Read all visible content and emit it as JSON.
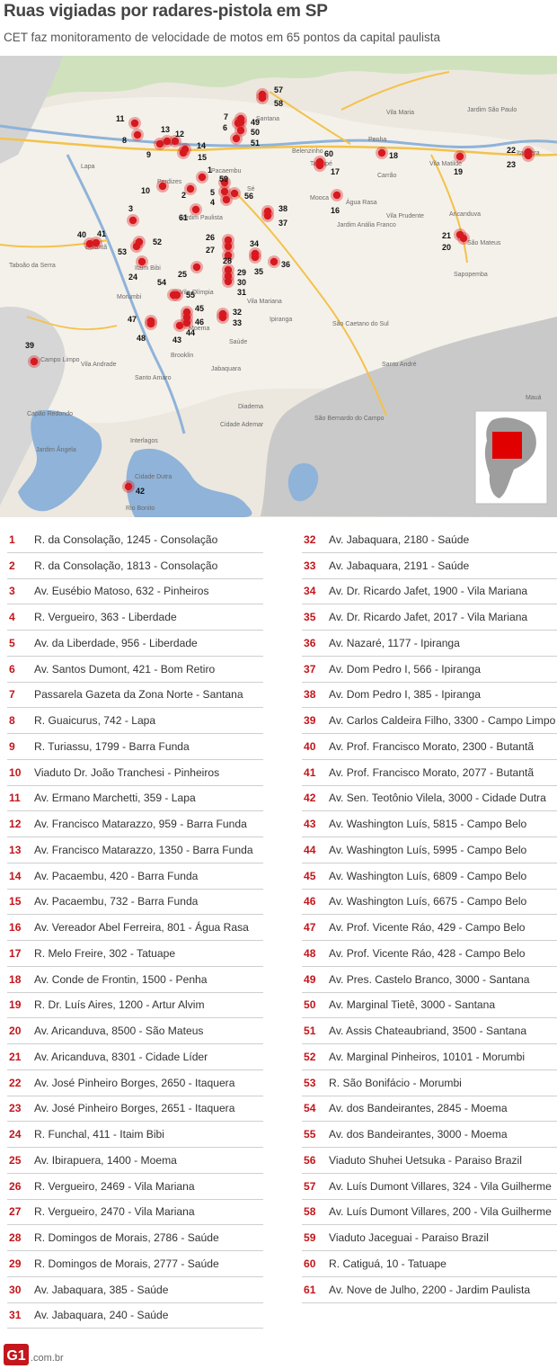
{
  "header": {
    "title": "Ruas vigiadas por radares-pistola em SP",
    "subtitle": "CET faz monitoramento de velocidade de motos em 65 pontos da capital paulista"
  },
  "map": {
    "place_labels": [
      "Santana",
      "Jardim São Paulo",
      "Penha",
      "Tatuapé",
      "Jardim Anália Franco",
      "Vila Matilde",
      "Itaquera",
      "São Mateus",
      "Jardim Paulista",
      "Perdizes",
      "Lapa",
      "Butantã",
      "Morumbi",
      "Taboão da Serra",
      "Vila Olímpia",
      "Moema",
      "Vila Mariana",
      "Ipiranga",
      "Saúde",
      "São Caetano do Sul",
      "Santo André",
      "São Bernardo do Campo",
      "Diadema",
      "Jabaquara",
      "Campo Limpo",
      "Vila Andrade",
      "Capão Redondo",
      "Cidade Dutra",
      "Interlagos",
      "Mauá",
      "Belenzinho",
      "Mooca",
      "Vila Prudente",
      "Sapopemba",
      "Pacaembu",
      "Sé",
      "Itaim Bibi",
      "Brooklin",
      "Santo Amaro",
      "Rio Bonito",
      "Cidade Ademar",
      "Jardim Ângela",
      "Vila Maria",
      "Água Rasa",
      "Carrão",
      "Aricanduva"
    ],
    "markers": [
      {
        "label": "1",
        "color": "#d7191f"
      },
      {
        "label": "2",
        "color": "#d7191f"
      },
      {
        "label": "3",
        "color": "#d7191f"
      },
      {
        "label": "4",
        "color": "#d7191f"
      },
      {
        "label": "5",
        "color": "#d7191f"
      },
      {
        "label": "6",
        "color": "#d7191f"
      },
      {
        "label": "7",
        "color": "#d7191f"
      },
      {
        "label": "8",
        "color": "#d7191f"
      },
      {
        "label": "9",
        "color": "#d7191f"
      },
      {
        "label": "10",
        "color": "#d7191f"
      },
      {
        "label": "11",
        "color": "#d7191f"
      },
      {
        "label": "12",
        "color": "#d7191f"
      },
      {
        "label": "13",
        "color": "#d7191f"
      },
      {
        "label": "14",
        "color": "#d7191f"
      },
      {
        "label": "15",
        "color": "#d7191f"
      },
      {
        "label": "16",
        "color": "#d7191f"
      },
      {
        "label": "17",
        "color": "#d7191f"
      },
      {
        "label": "18",
        "color": "#d7191f"
      },
      {
        "label": "19",
        "color": "#d7191f"
      },
      {
        "label": "20",
        "color": "#d7191f"
      },
      {
        "label": "21",
        "color": "#d7191f"
      },
      {
        "label": "22",
        "color": "#d7191f"
      },
      {
        "label": "23",
        "color": "#d7191f"
      },
      {
        "label": "24",
        "color": "#d7191f"
      },
      {
        "label": "25",
        "color": "#d7191f"
      },
      {
        "label": "26",
        "color": "#d7191f"
      },
      {
        "label": "27",
        "color": "#d7191f"
      },
      {
        "label": "28",
        "color": "#d7191f"
      },
      {
        "label": "29",
        "color": "#d7191f"
      },
      {
        "label": "30",
        "color": "#d7191f"
      },
      {
        "label": "31",
        "color": "#d7191f"
      },
      {
        "label": "32",
        "color": "#d7191f"
      },
      {
        "label": "33",
        "color": "#d7191f"
      },
      {
        "label": "34",
        "color": "#d7191f"
      },
      {
        "label": "35",
        "color": "#d7191f"
      },
      {
        "label": "36",
        "color": "#d7191f"
      },
      {
        "label": "37",
        "color": "#d7191f"
      },
      {
        "label": "38",
        "color": "#d7191f"
      },
      {
        "label": "39",
        "color": "#d7191f"
      },
      {
        "label": "40",
        "color": "#d7191f"
      },
      {
        "label": "41",
        "color": "#d7191f"
      },
      {
        "label": "42",
        "color": "#d7191f"
      },
      {
        "label": "43",
        "color": "#d7191f"
      },
      {
        "label": "44",
        "color": "#d7191f"
      },
      {
        "label": "45",
        "color": "#d7191f"
      },
      {
        "label": "46",
        "color": "#d7191f"
      },
      {
        "label": "47",
        "color": "#d7191f"
      },
      {
        "label": "48",
        "color": "#d7191f"
      },
      {
        "label": "49",
        "color": "#d7191f"
      },
      {
        "label": "50",
        "color": "#d7191f"
      },
      {
        "label": "51",
        "color": "#d7191f"
      },
      {
        "label": "52",
        "color": "#d7191f"
      },
      {
        "label": "53",
        "color": "#d7191f"
      },
      {
        "label": "54",
        "color": "#d7191f"
      },
      {
        "label": "55",
        "color": "#d7191f"
      },
      {
        "label": "56",
        "color": "#d7191f"
      },
      {
        "label": "57",
        "color": "#d7191f"
      },
      {
        "label": "58",
        "color": "#d7191f"
      },
      {
        "label": "59",
        "color": "#d7191f"
      },
      {
        "label": "60",
        "color": "#d7191f"
      },
      {
        "label": "61",
        "color": "#d7191f"
      }
    ],
    "inset_highlight_color": "#e00000"
  },
  "locations_left": [
    {
      "num": "1",
      "text": "R. da Consolação, 1245 - Consolação"
    },
    {
      "num": "2",
      "text": "R. da Consolação, 1813 - Consolação"
    },
    {
      "num": "3",
      "text": "Av. Eusébio Matoso, 632 - Pinheiros"
    },
    {
      "num": "4",
      "text": "R. Vergueiro, 363 - Liberdade"
    },
    {
      "num": "5",
      "text": "Av. da Liberdade, 956 - Liberdade"
    },
    {
      "num": "6",
      "text": "Av. Santos Dumont, 421 - Bom Retiro"
    },
    {
      "num": "7",
      "text": "Passarela Gazeta da Zona Norte - Santana"
    },
    {
      "num": "8",
      "text": "R. Guaicurus, 742 - Lapa"
    },
    {
      "num": "9",
      "text": "R. Turiassu, 1799 - Barra Funda"
    },
    {
      "num": "10",
      "text": "Viaduto Dr. João Tranchesi - Pinheiros"
    },
    {
      "num": "11",
      "text": "Av. Ermano Marchetti, 359 - Lapa"
    },
    {
      "num": "12",
      "text": "Av. Francisco Matarazzo, 959 - Barra Funda"
    },
    {
      "num": "13",
      "text": "Av. Francisco Matarazzo, 1350 - Barra Funda"
    },
    {
      "num": "14",
      "text": "Av. Pacaembu, 420 - Barra Funda"
    },
    {
      "num": "15",
      "text": "Av. Pacaembu, 732 - Barra Funda"
    },
    {
      "num": "16",
      "text": "Av. Vereador Abel Ferreira, 801 - Água Rasa"
    },
    {
      "num": "17",
      "text": "R. Melo Freire, 302 - Tatuape"
    },
    {
      "num": "18",
      "text": "Av. Conde de Frontin, 1500 - Penha"
    },
    {
      "num": "19",
      "text": "R. Dr. Luís Aires, 1200 - Artur Alvim"
    },
    {
      "num": "20",
      "text": "Av. Aricanduva, 8500 - São Mateus"
    },
    {
      "num": "21",
      "text": "Av. Aricanduva, 8301 - Cidade Líder"
    },
    {
      "num": "22",
      "text": "Av. José Pinheiro Borges, 2650 - Itaquera"
    },
    {
      "num": "23",
      "text": "Av. José Pinheiro Borges, 2651 - Itaquera"
    },
    {
      "num": "24",
      "text": "R. Funchal, 411 - Itaim Bibi"
    },
    {
      "num": "25",
      "text": "Av. Ibirapuera, 1400 - Moema"
    },
    {
      "num": "26",
      "text": "R. Vergueiro, 2469 - Vila Mariana"
    },
    {
      "num": "27",
      "text": "R. Vergueiro, 2470 - Vila Mariana"
    },
    {
      "num": "28",
      "text": "R. Domingos de Morais, 2786 - Saúde"
    },
    {
      "num": "29",
      "text": "R. Domingos de Morais, 2777 - Saúde"
    },
    {
      "num": "30",
      "text": "Av. Jabaquara, 385 - Saúde"
    },
    {
      "num": "31",
      "text": "Av. Jabaquara, 240 - Saúde"
    }
  ],
  "locations_right": [
    {
      "num": "32",
      "text": "Av. Jabaquara, 2180 - Saúde"
    },
    {
      "num": "33",
      "text": "Av. Jabaquara, 2191 - Saúde"
    },
    {
      "num": "34",
      "text": "Av. Dr. Ricardo Jafet, 1900 - Vila Mariana"
    },
    {
      "num": "35",
      "text": "Av. Dr. Ricardo Jafet, 2017 - Vila Mariana"
    },
    {
      "num": "36",
      "text": "Av. Nazaré, 1177 - Ipiranga"
    },
    {
      "num": "37",
      "text": "Av. Dom Pedro I, 566 - Ipiranga"
    },
    {
      "num": "38",
      "text": "Av. Dom Pedro I, 385 - Ipiranga"
    },
    {
      "num": "39",
      "text": "Av. Carlos Caldeira Filho, 3300 - Campo Limpo"
    },
    {
      "num": "40",
      "text": "Av. Prof. Francisco Morato, 2300 - Butantã"
    },
    {
      "num": "41",
      "text": "Av. Prof. Francisco Morato, 2077 - Butantã"
    },
    {
      "num": "42",
      "text": "Av. Sen. Teotônio Vilela, 3000 - Cidade Dutra"
    },
    {
      "num": "43",
      "text": "Av. Washington Luís, 5815 - Campo Belo"
    },
    {
      "num": "44",
      "text": "Av. Washington Luís, 5995 - Campo Belo"
    },
    {
      "num": "45",
      "text": "Av. Washington Luís, 6809 - Campo Belo"
    },
    {
      "num": "46",
      "text": "Av. Washington Luís, 6675 - Campo Belo"
    },
    {
      "num": "47",
      "text": "Av. Prof. Vicente Ráo, 429 - Campo Belo"
    },
    {
      "num": "48",
      "text": "Av. Prof. Vicente Ráo, 428 - Campo Belo"
    },
    {
      "num": "49",
      "text": "Av. Pres. Castelo Branco, 3000 - Santana"
    },
    {
      "num": "50",
      "text": "Av. Marginal Tietê, 3000 - Santana"
    },
    {
      "num": "51",
      "text": "Av. Assis Chateaubriand, 3500 - Santana"
    },
    {
      "num": "52",
      "text": "Av. Marginal Pinheiros, 10101 - Morumbi"
    },
    {
      "num": "53",
      "text": "R. São Bonifácio - Morumbi"
    },
    {
      "num": "54",
      "text": "Av. dos Bandeirantes, 2845 - Moema"
    },
    {
      "num": "55",
      "text": "Av. dos Bandeirantes, 3000 - Moema"
    },
    {
      "num": "56",
      "text": "Viaduto Shuhei Uetsuka - Paraiso Brazil"
    },
    {
      "num": "57",
      "text": "Av. Luís Dumont Villares, 324 - Vila Guilherme"
    },
    {
      "num": "58",
      "text": "Av. Luís Dumont Villares, 200 - Vila Guilherme"
    },
    {
      "num": "59",
      "text": "Viaduto Jaceguai - Paraiso Brazil"
    },
    {
      "num": "60",
      "text": "R. Catiguá, 10 - Tatuape"
    },
    {
      "num": "61",
      "text": "Av. Nove de Julho, 2200 - Jardim Paulista"
    }
  ],
  "footer": {
    "logo_text": "G1",
    "domain": ".com.br",
    "logo_color": "#c4161c"
  }
}
